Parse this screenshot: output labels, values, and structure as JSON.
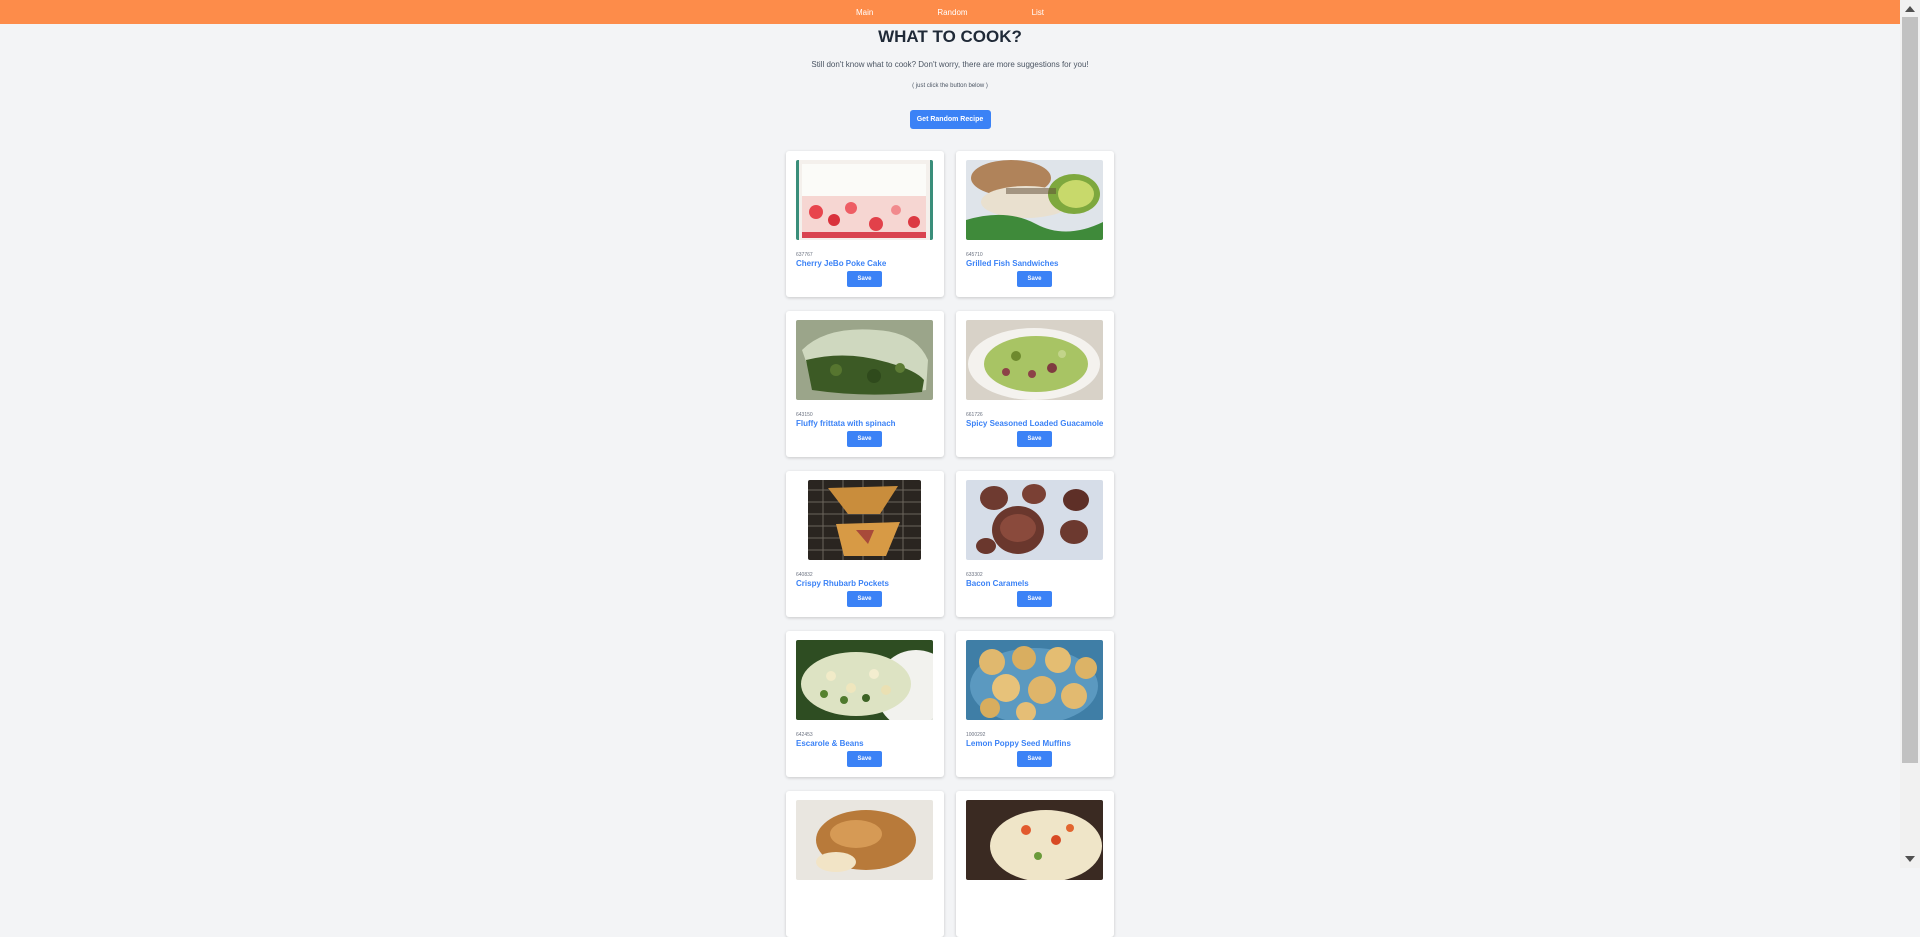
{
  "nav": {
    "links": [
      "Main",
      "Random",
      "List"
    ]
  },
  "header": {
    "title": "WHAT TO COOK?",
    "subtitle": "Still don't know what to cook? Don't worry, there are more suggestions for you!",
    "hint": "( just click the button below )",
    "random_button": "Get Random Recipe"
  },
  "recipes": [
    {
      "id": "637767",
      "title": "Cherry JeBo Poke Cake",
      "save_label": "Save",
      "image_icon": "cake-image"
    },
    {
      "id": "645710",
      "title": "Grilled Fish Sandwiches",
      "save_label": "Save",
      "image_icon": "sandwich-image"
    },
    {
      "id": "643150",
      "title": "Fluffy frittata with spinach",
      "save_label": "Save",
      "image_icon": "frittata-image"
    },
    {
      "id": "661726",
      "title": "Spicy Seasoned Loaded Guacamole",
      "save_label": "Save",
      "image_icon": "guacamole-image"
    },
    {
      "id": "640832",
      "title": "Crispy Rhubarb Pockets",
      "save_label": "Save",
      "image_icon": "pastry-image"
    },
    {
      "id": "633302",
      "title": "Bacon Caramels",
      "save_label": "Save",
      "image_icon": "caramels-image"
    },
    {
      "id": "642453",
      "title": "Escarole & Beans",
      "save_label": "Save",
      "image_icon": "pasta-salad-image"
    },
    {
      "id": "1000292",
      "title": "Lemon Poppy Seed Muffins",
      "save_label": "Save",
      "image_icon": "muffins-image"
    }
  ],
  "colors": {
    "navbar": "#fd8c4a",
    "accent": "#3b82f6",
    "background": "#f3f4f6"
  }
}
